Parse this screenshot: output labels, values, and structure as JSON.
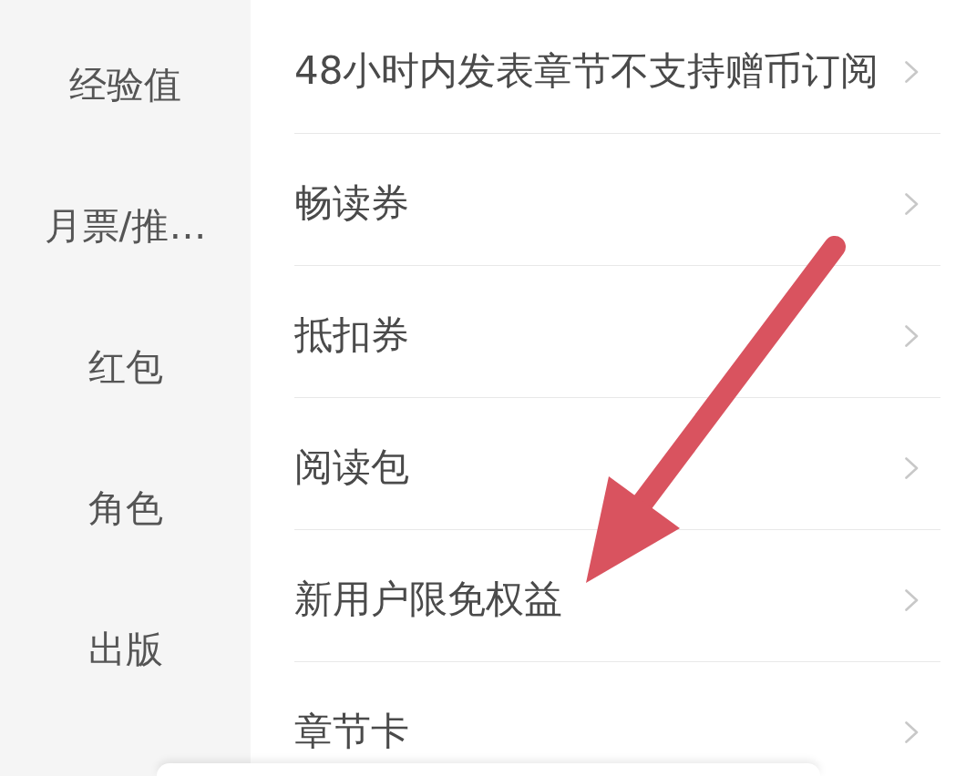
{
  "sidebar": {
    "items": [
      {
        "label": "经验值"
      },
      {
        "label": "月票/推…"
      },
      {
        "label": "红包"
      },
      {
        "label": "角色"
      },
      {
        "label": "出版"
      }
    ]
  },
  "list": {
    "rows": [
      {
        "label": "48小时内发表章节不支持赠币订阅"
      },
      {
        "label": "畅读券"
      },
      {
        "label": "抵扣券"
      },
      {
        "label": "阅读包"
      },
      {
        "label": "新用户限免权益"
      },
      {
        "label": "章节卡"
      }
    ]
  }
}
